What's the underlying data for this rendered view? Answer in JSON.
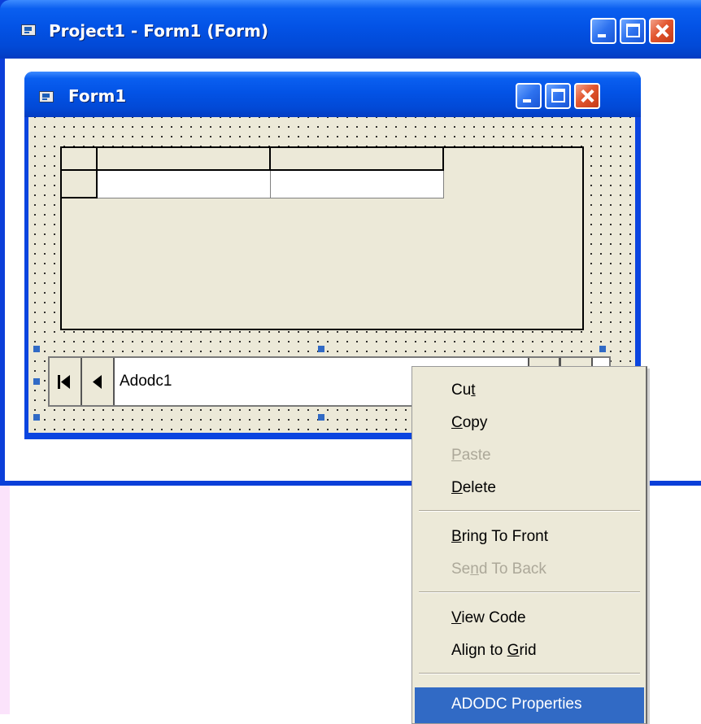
{
  "app": {
    "outer_title": "Project1 - Form1 (Form)",
    "form_title": "Form1"
  },
  "caption_buttons": [
    "minimize",
    "maximize",
    "close"
  ],
  "grid": {
    "columns": 3,
    "rows": 2,
    "header_cells": [
      "",
      "",
      ""
    ],
    "row_cells": [
      "",
      "",
      ""
    ]
  },
  "adodc": {
    "caption": "Adodc1",
    "buttons": [
      "first-record",
      "previous-record",
      "next-record",
      "last-record"
    ]
  },
  "context_menu": {
    "items": [
      {
        "pre": "Cu",
        "u": "t",
        "post": "",
        "enabled": true
      },
      {
        "pre": "",
        "u": "C",
        "post": "opy",
        "enabled": true
      },
      {
        "pre": "",
        "u": "P",
        "post": "aste",
        "enabled": false
      },
      {
        "pre": "",
        "u": "D",
        "post": "elete",
        "enabled": true
      },
      {
        "pre": "",
        "u": "B",
        "post": "ring To Front",
        "enabled": true
      },
      {
        "pre": "Se",
        "u": "n",
        "post": "d To Back",
        "enabled": false
      },
      {
        "pre": "",
        "u": "V",
        "post": "iew Code",
        "enabled": true
      },
      {
        "pre": "Align to ",
        "u": "G",
        "post": "rid",
        "enabled": true
      },
      {
        "pre": "ADODC Properties",
        "u": "",
        "post": "",
        "enabled": true,
        "highlighted": true
      }
    ]
  },
  "colors": {
    "titlebar": "#0353e6",
    "form_background": "#ece9d8",
    "selection": "#316ac5",
    "close_button": "#e2562f"
  }
}
